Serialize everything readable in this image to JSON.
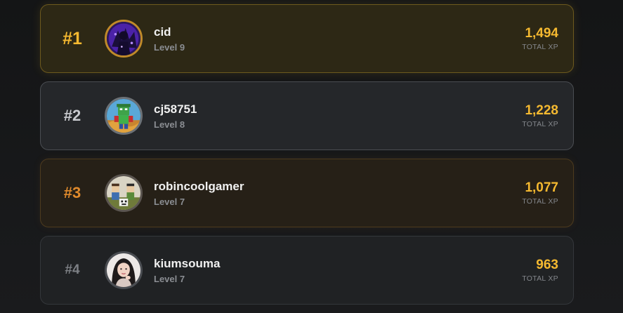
{
  "leaderboard": {
    "entries": [
      {
        "rank": "#1",
        "name": "cid",
        "level": "Level 9",
        "xp": "1,494",
        "xp_label": "TOTAL XP",
        "avatar": "purple-character-avatar"
      },
      {
        "rank": "#2",
        "name": "cj58751",
        "level": "Level 8",
        "xp": "1,228",
        "xp_label": "TOTAL XP",
        "avatar": "green-blocky-character-avatar"
      },
      {
        "rank": "#3",
        "name": "robincoolgamer",
        "level": "Level 7",
        "xp": "1,077",
        "xp_label": "TOTAL XP",
        "avatar": "blocky-game-characters-avatar"
      },
      {
        "rank": "#4",
        "name": "kiumsouma",
        "level": "Level 7",
        "xp": "963",
        "xp_label": "TOTAL XP",
        "avatar": "portrait-photo-avatar"
      }
    ]
  },
  "colors": {
    "accent_gold": "#f5b930",
    "rank_silver": "#c9cbcf",
    "rank_bronze": "#e08a2c",
    "background": "#141516"
  }
}
